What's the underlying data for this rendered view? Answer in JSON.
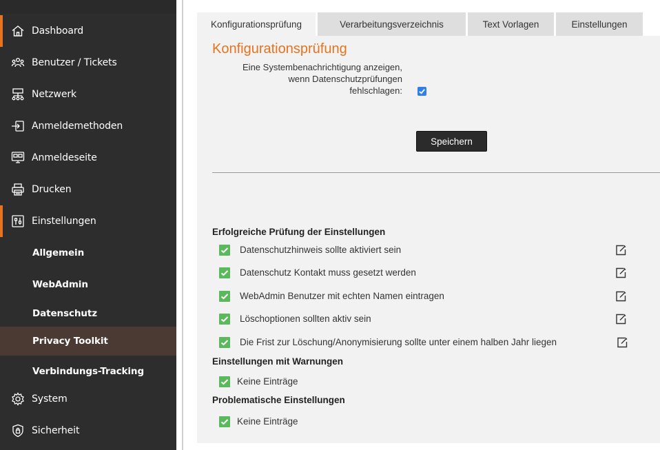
{
  "sidebar": {
    "items": [
      {
        "label": "Dashboard",
        "icon": "home-icon"
      },
      {
        "label": "Benutzer / Tickets",
        "icon": "users-icon"
      },
      {
        "label": "Netzwerk",
        "icon": "network-icon"
      },
      {
        "label": "Anmeldemethoden",
        "icon": "login-methods-icon"
      },
      {
        "label": "Anmeldeseite",
        "icon": "login-page-icon"
      },
      {
        "label": "Drucken",
        "icon": "printer-icon"
      },
      {
        "label": "Einstellungen",
        "icon": "settings-sliders-icon"
      }
    ],
    "subitems": [
      {
        "label": "Allgemein"
      },
      {
        "label": "WebAdmin"
      },
      {
        "label": "Datenschutz"
      },
      {
        "label": "Privacy Toolkit"
      },
      {
        "label": "Verbindungs-Tracking"
      }
    ],
    "bottom_items": [
      {
        "label": "System",
        "icon": "gear-icon"
      },
      {
        "label": "Sicherheit",
        "icon": "shield-icon"
      }
    ],
    "accent_color": "#e5731f",
    "selected_subitem": "Privacy Toolkit"
  },
  "tabs": [
    {
      "label": "Konfigurationsprüfung",
      "active": true
    },
    {
      "label": "Verarbeitungsverzeichnis",
      "active": false
    },
    {
      "label": "Text Vorlagen",
      "active": false
    },
    {
      "label": "Einstellungen",
      "active": false
    }
  ],
  "main": {
    "title": "Konfigurationsprüfung",
    "option_label": "Eine Systembenachrichtigung anzeigen,\nwenn Datenschutzprüfungen\nfehlschlagen:",
    "option_checked": true,
    "save_label": "Speichern",
    "sections": [
      {
        "heading": "Erfolgreiche Prüfung der Einstellungen",
        "rows": [
          {
            "text": "Datenschutzhinweis sollte aktiviert sein",
            "editable": true
          },
          {
            "text": "Datenschutz Kontakt muss gesetzt werden",
            "editable": true
          },
          {
            "text": "WebAdmin Benutzer mit echten Namen eintragen",
            "editable": true
          },
          {
            "text": "Löschoptionen sollten aktiv sein",
            "editable": true
          },
          {
            "text": "Die Frist zur Löschung/Anonymisierung sollte unter einem halben Jahr liegen",
            "editable": true
          }
        ]
      },
      {
        "heading": "Einstellungen mit Warnungen",
        "rows": [
          {
            "text": "Keine Einträge",
            "editable": false
          }
        ]
      },
      {
        "heading": "Problematische Einstellungen",
        "rows": [
          {
            "text": "Keine Einträge",
            "editable": false
          }
        ]
      }
    ]
  },
  "colors": {
    "title_orange": "#e5731f",
    "check_green": "#5cb85c",
    "checkbox_blue": "#2f7fe6"
  }
}
